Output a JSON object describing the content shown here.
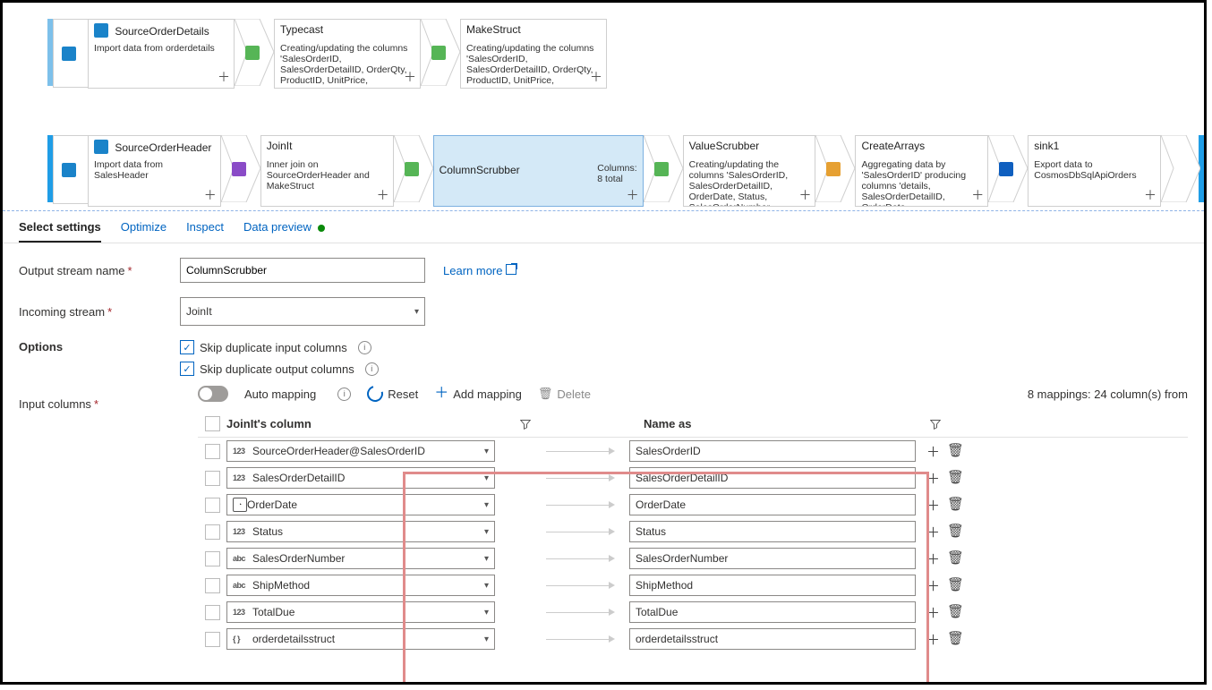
{
  "flow": {
    "row1": [
      {
        "title": "SourceOrderDetails",
        "desc": "Import data from orderdetails",
        "icon": "blue",
        "mini": true
      },
      {
        "title": "Typecast",
        "desc": "Creating/updating the columns 'SalesOrderID, SalesOrderDetailID, OrderQty, ProductID, UnitPrice,",
        "icon": "green",
        "mini": false
      },
      {
        "title": "MakeStruct",
        "desc": "Creating/updating the columns 'SalesOrderID, SalesOrderDetailID, OrderQty, ProductID, UnitPrice,",
        "icon": "green",
        "mini": false
      }
    ],
    "row2": [
      {
        "title": "SourceOrderHeader",
        "desc": "Import data from SalesHeader",
        "icon": "blue",
        "mini": true
      },
      {
        "title": "JoinIt",
        "desc": "Inner join on SourceOrderHeader and MakeStruct",
        "icon": "purple",
        "mini": false
      },
      {
        "title": "ColumnScrubber",
        "desc": "Columns:\n8 total",
        "selected": true,
        "icon": "green",
        "mini": false
      },
      {
        "title": "ValueScrubber",
        "desc": "Creating/updating the columns 'SalesOrderID, SalesOrderDetailID, OrderDate, Status, SalesOrderNumber,",
        "icon": "green",
        "mini": false
      },
      {
        "title": "CreateArrays",
        "desc": "Aggregating data by 'SalesOrderID' producing columns 'details, SalesOrderDetailID, OrderDate,",
        "icon": "orange",
        "mini": false
      },
      {
        "title": "sink1",
        "desc": "Export data to CosmosDbSqlApiOrders",
        "icon": "deepblue",
        "mini": false
      }
    ]
  },
  "tabs": {
    "select": "Select settings",
    "optimize": "Optimize",
    "inspect": "Inspect",
    "preview": "Data preview"
  },
  "form": {
    "outputLabel": "Output stream name",
    "outputValue": "ColumnScrubber",
    "learn": "Learn more",
    "incomingLabel": "Incoming stream",
    "incomingValue": "JoinIt",
    "optionsLabel": "Options",
    "skipIn": "Skip duplicate input columns",
    "skipOut": "Skip duplicate output columns",
    "inputColsLabel": "Input columns",
    "autoMap": "Auto mapping",
    "reset": "Reset",
    "addMap": "Add mapping",
    "delete": "Delete",
    "mapCount": "8 mappings: 24 column(s) from"
  },
  "grid": {
    "h1": "JoinIt's column",
    "h2": "Name as",
    "rows": [
      {
        "type": "123",
        "src": "SourceOrderHeader@SalesOrderID",
        "dst": "SalesOrderID"
      },
      {
        "type": "123",
        "src": "SalesOrderDetailID",
        "dst": "SalesOrderDetailID"
      },
      {
        "type": "date",
        "src": "OrderDate",
        "dst": "OrderDate"
      },
      {
        "type": "123",
        "src": "Status",
        "dst": "Status"
      },
      {
        "type": "abc",
        "src": "SalesOrderNumber",
        "dst": "SalesOrderNumber"
      },
      {
        "type": "abc",
        "src": "ShipMethod",
        "dst": "ShipMethod"
      },
      {
        "type": "123",
        "src": "TotalDue",
        "dst": "TotalDue"
      },
      {
        "type": "{ }",
        "src": "orderdetailsstruct",
        "dst": "orderdetailsstruct"
      }
    ]
  }
}
